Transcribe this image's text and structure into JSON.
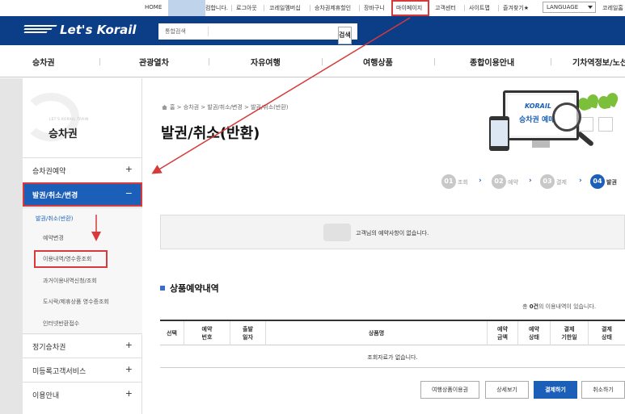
{
  "utility_bar": {
    "greeting_suffix": "컴합니다.",
    "links": [
      "HOME",
      "로그아웃",
      "코레일멤버십",
      "승차권제휴할인",
      "장바구니",
      "마이페이지",
      "고객센터",
      "사이트맵",
      "즐겨찾기★"
    ],
    "language_label": "LANGUAGE",
    "trailing": "코레일홈"
  },
  "header": {
    "logo_text": "Let's Korail",
    "search_placeholder": "통합검색",
    "search_button": "검색"
  },
  "main_nav": [
    "승차권",
    "관광열차",
    "자유여행",
    "여행상품",
    "종합이용안내",
    "기차역정보/노선"
  ],
  "sidebar": {
    "subtitle": "LET'S KORAIL TRAIN",
    "title": "승차권",
    "items": [
      {
        "label": "승차권예약",
        "sign": "+"
      },
      {
        "label": "발권/취소/변경",
        "sign": "−"
      },
      {
        "label": "정기승차권",
        "sign": "+"
      },
      {
        "label": "미등록고객서비스",
        "sign": "+"
      },
      {
        "label": "이용안내",
        "sign": "+"
      }
    ],
    "sub_items": [
      "발권/취소(반환)",
      "예약변경",
      "이용내역/영수증조회",
      "과거이용내역신청/조회",
      "도시락/제휴상품 영수증조회",
      "인터넷반환접수"
    ]
  },
  "content": {
    "breadcrumb": "홈 > 승차권 > 발권/취소/변경 > 발권/취소(반환)",
    "page_title": "발권/취소(반환)",
    "hero": {
      "brand": "KORAIL",
      "caption": "승차권 예매"
    },
    "steps": [
      {
        "num": "01",
        "label": "조회"
      },
      {
        "num": "02",
        "label": "예약"
      },
      {
        "num": "03",
        "label": "결제"
      },
      {
        "num": "04",
        "label": "발권"
      }
    ],
    "notice_message": "고객님의 예약사항이 없습니다.",
    "section_title": "상품예약내역",
    "count_prefix": "총",
    "count_value": "0건",
    "count_suffix": "의 이용내역이 있습니다.",
    "table": {
      "headers": [
        "선택",
        "예약\n번호",
        "출발\n일자",
        "상품명",
        "예약\n금액",
        "예약\n상태",
        "결제\n기한일",
        "결제\n상태"
      ],
      "empty_message": "조회자료가 없습니다."
    },
    "buttons": [
      "여행상품이용권",
      "상세보기",
      "결제하기",
      "취소하기"
    ]
  },
  "colors": {
    "brand_blue": "#0b3e87",
    "accent_blue": "#1b5fb8",
    "annotation_red": "#d63a3a"
  }
}
